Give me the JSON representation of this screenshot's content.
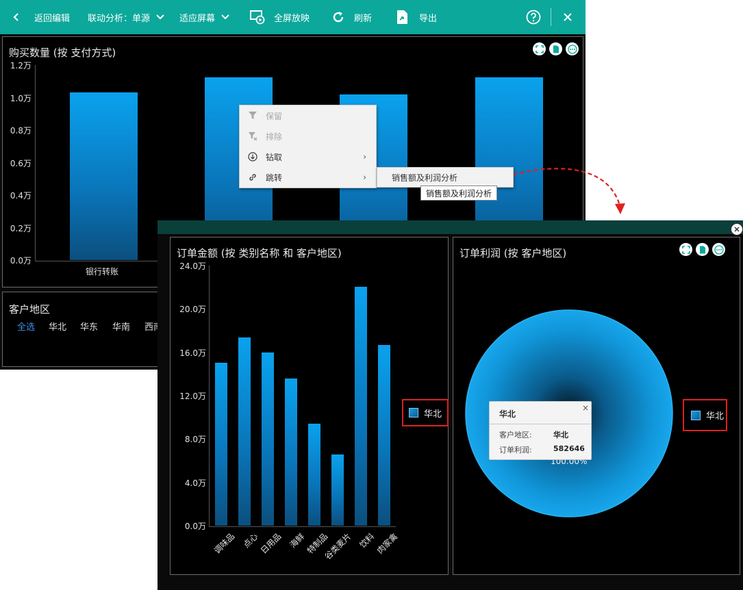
{
  "toolbar": {
    "back_label": "返回编辑",
    "linkage_label": "联动分析：单源",
    "fit_label": "适应屏幕",
    "fullscreen_label": "全屏放映",
    "refresh_label": "刷新",
    "export_label": "导出",
    "help_icon": "help-circle-icon",
    "close_icon": "close-icon"
  },
  "colors": {
    "accent": "#0ba89b",
    "bar_top": "#0aa2ee",
    "bar_bottom": "#0b4f7e",
    "highlight_border": "#e02020"
  },
  "back_chart": {
    "title": "购买数量 (按 支付方式)",
    "y_ticks": [
      "1.2万",
      "1.0万",
      "0.8万",
      "0.6万",
      "0.4万",
      "0.2万",
      "0.0万"
    ],
    "first_category_label": "银行转账"
  },
  "filter": {
    "title": "客户地区",
    "items": [
      "全选",
      "华北",
      "华东",
      "华南",
      "西南"
    ]
  },
  "context_menu": {
    "items": [
      "保留",
      "排除",
      "钻取",
      "跳转"
    ],
    "submenu_item": "销售额及利润分析",
    "tooltip": "销售额及利润分析"
  },
  "bar_panel": {
    "title": "订单金额 (按 类别名称 和 客户地区)",
    "y_ticks": [
      "24.0万",
      "20.0万",
      "16.0万",
      "12.0万",
      "8.0万",
      "4.0万",
      "0.0万"
    ],
    "legend": "华北"
  },
  "pie_panel": {
    "title": "订单利润 (按 客户地区)",
    "legend": "华北",
    "slice_label": "100.00%",
    "tooltip": {
      "title": "华北",
      "rows": [
        {
          "key": "客户地区:",
          "value": "华北"
        },
        {
          "key": "订单利润:",
          "value": "582646"
        }
      ]
    }
  },
  "chart_data": [
    {
      "type": "bar",
      "title": "购买数量 (按 支付方式)",
      "categories": [
        "银行转账",
        "",
        "",
        ""
      ],
      "values": [
        10300,
        11250,
        10200,
        11250
      ],
      "unit": "万",
      "ylim": [
        0,
        12000
      ]
    },
    {
      "type": "bar",
      "title": "订单金额 (按 类别名称 和 客户地区)",
      "categories": [
        "调味品",
        "点心",
        "日用品",
        "海鲜",
        "特制品",
        "谷类麦片",
        "饮料",
        "肉家禽"
      ],
      "series": [
        {
          "name": "华北",
          "values": [
            150500,
            173500,
            160000,
            135500,
            94000,
            65500,
            220500,
            166500
          ]
        }
      ],
      "unit": "万",
      "ylim": [
        0,
        240000
      ]
    },
    {
      "type": "pie",
      "title": "订单利润 (按 客户地区)",
      "slices": [
        {
          "name": "华北",
          "value": 582646,
          "percent": "100.00%"
        }
      ]
    }
  ]
}
